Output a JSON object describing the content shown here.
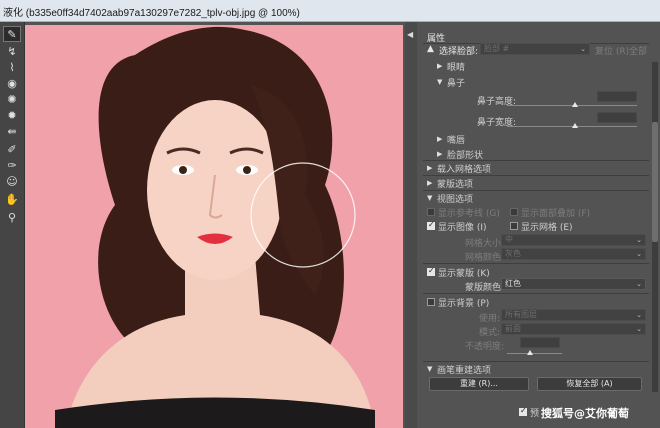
{
  "window": {
    "title": "液化 (b335e0ff34d7402aab97a130297e7282_tplv-obj.jpg @ 100%)"
  },
  "tools": [
    {
      "name": "forward-warp-tool-icon",
      "glyph": "✎",
      "active": true
    },
    {
      "name": "reconstruct-tool-icon",
      "glyph": "↯"
    },
    {
      "name": "smooth-tool-icon",
      "glyph": "⌇"
    },
    {
      "name": "twirl-tool-icon",
      "glyph": "◉"
    },
    {
      "name": "pucker-tool-icon",
      "glyph": "✺"
    },
    {
      "name": "bloat-tool-icon",
      "glyph": "✹"
    },
    {
      "name": "push-left-tool-icon",
      "glyph": "⇚"
    },
    {
      "name": "freeze-mask-tool-icon",
      "glyph": "✐"
    },
    {
      "name": "thaw-mask-tool-icon",
      "glyph": "✑"
    },
    {
      "name": "face-tool-icon",
      "glyph": "☺"
    },
    {
      "name": "hand-tool-icon",
      "glyph": "✋"
    },
    {
      "name": "zoom-tool-icon",
      "glyph": "⚲"
    }
  ],
  "panel": {
    "header": "属性",
    "face_select": {
      "label": "选择脸部:",
      "value": "脸部 #",
      "reset": "复位 (R)",
      "all": "全部"
    },
    "face": {
      "eyes": "眼睛",
      "nose": "鼻子",
      "nose_height": "鼻子高度:",
      "nose_width": "鼻子宽度:",
      "mouth": "嘴唇",
      "face_shape": "脸部形状"
    },
    "load_mesh": "载入网格选项",
    "mask_options": "蒙版选项",
    "view_options": {
      "header": "视图选项",
      "show_guides": "显示参考线 (G)",
      "show_face_overlay": "显示面部叠加 (F)",
      "show_image": "显示图像 (I)",
      "show_mesh": "显示网格 (E)",
      "mesh_size_label": "网格大小:",
      "mesh_size_value": "中",
      "mesh_color_label": "网格颜色:",
      "mesh_color_value": "灰色",
      "show_mask": "显示蒙版 (K)",
      "mask_color_label": "蒙版颜色:",
      "mask_color_value": "红色",
      "show_backdrop": "显示背景 (P)",
      "use_label": "使用:",
      "use_value": "所有图层",
      "mode_label": "模式:",
      "mode_value": "前面",
      "opacity_label": "不透明度:"
    },
    "reconstruct": {
      "header": "画笔重建选项",
      "rebuild": "重建 (R)...",
      "restore_all": "恢复全部 (A)"
    },
    "preview_label": "预"
  },
  "watermark": "搜狐号@艾你葡萄",
  "colors": {
    "background": "#f0a0a8",
    "panel": "#535353",
    "titlebar": "#dfe6ee"
  }
}
